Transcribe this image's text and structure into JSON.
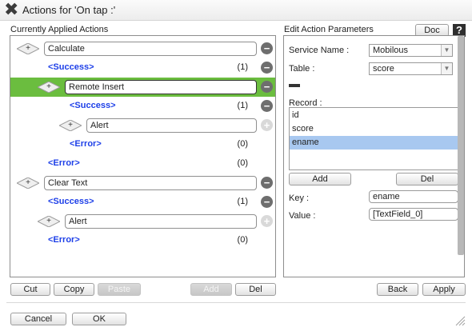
{
  "window": {
    "title": "Actions for 'On tap :'"
  },
  "left": {
    "title": "Currently Applied Actions",
    "rows": [
      {
        "kind": "action",
        "label": "Calculate"
      },
      {
        "kind": "status",
        "label": "<Success>",
        "count": "(1)"
      },
      {
        "kind": "action",
        "label": "Remote Insert"
      },
      {
        "kind": "status",
        "label": "<Success>",
        "count": "(1)"
      },
      {
        "kind": "action",
        "label": "Alert"
      },
      {
        "kind": "status",
        "label": "<Error>",
        "count": "(0)"
      },
      {
        "kind": "status",
        "label": "<Error>",
        "count": "(0)"
      },
      {
        "kind": "action",
        "label": "Clear Text"
      },
      {
        "kind": "status",
        "label": "<Success>",
        "count": "(1)"
      },
      {
        "kind": "action",
        "label": "Alert"
      },
      {
        "kind": "status",
        "label": "<Error>",
        "count": "(0)"
      }
    ],
    "buttons": {
      "cut": "Cut",
      "copy": "Copy",
      "paste": "Paste",
      "add": "Add",
      "del": "Del"
    }
  },
  "right": {
    "title": "Edit Action Parameters",
    "doc": "Doc",
    "help": "?",
    "service_name_label": "Service Name :",
    "service_name_value": "Mobilous",
    "table_label": "Table :",
    "table_value": "score",
    "record_label": "Record :",
    "records": [
      "id",
      "score",
      "ename"
    ],
    "add": "Add",
    "del": "Del",
    "key_label": "Key :",
    "key_value": "ename",
    "value_label": "Value :",
    "value_value": "[TextField_0]",
    "back": "Back",
    "apply": "Apply"
  },
  "footer": {
    "cancel": "Cancel",
    "ok": "OK"
  },
  "colors": {
    "selected_row": "#6bbd3f",
    "status_text": "#1d3fe8",
    "selected_record": "#a8c8f0"
  }
}
